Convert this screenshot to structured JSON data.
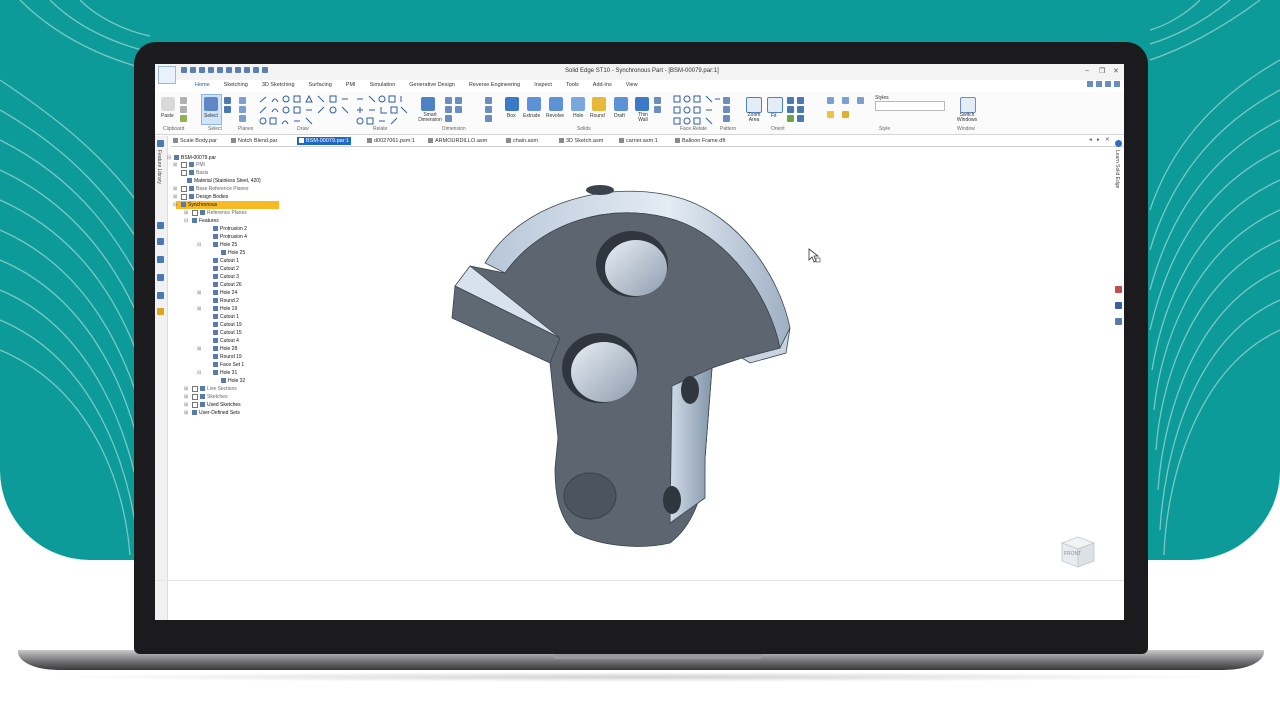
{
  "app": {
    "title": "Solid Edge ST10 - Synchronous Part - [BSM-00079.par:1]",
    "window_buttons": {
      "minimize": "–",
      "restore": "❐",
      "close": "✕"
    }
  },
  "ribbon": {
    "tabs": [
      "Home",
      "Sketching",
      "3D Sketching",
      "Surfacing",
      "PMI",
      "Simulation",
      "Generative Design",
      "Reverse Engineering",
      "Inspect",
      "Tools",
      "Add-Ins",
      "View"
    ],
    "active_tab": "Home",
    "buttons": {
      "paste": "Paste",
      "select": "Select",
      "smart_dimension": "Smart Dimension",
      "box": "Box",
      "extrude": "Extrude",
      "revolve": "Revolve",
      "hole": "Hole",
      "round": "Round",
      "draft": "Draft",
      "thin_wall": "Thin Wall",
      "zoom_area": "Zoom Area",
      "fit": "Fit",
      "styles": "Styles",
      "switch_windows": "Switch Windows"
    },
    "groups": {
      "clipboard": "Clipboard",
      "select": "Select",
      "planes": "Planes",
      "draw": "Draw",
      "relate": "Relate",
      "dimension": "Dimension",
      "solids": "Solids",
      "face_relate": "Face Relate",
      "pattern": "Pattern",
      "orient": "Orient",
      "style": "Style",
      "window": "Window"
    }
  },
  "doc_tabs": [
    "Scale Body.par",
    "Notch Blend.par",
    "BSM-00079.par:1",
    "d0027061.psm:1",
    "ARMOURDILLO.asm",
    "chain.asm",
    "3D Sketch.asm",
    "carrier.asm:1",
    "Balloon Frame.dft"
  ],
  "active_doc_tab": "BSM-00079.par:1",
  "left_strip": {
    "label": "Feature Library"
  },
  "right_strip": {
    "label": "Learn Solid Edge"
  },
  "tree": {
    "root": "BSM-00079.par",
    "items": [
      "PMI",
      "Basis",
      "Material (Stainless Steel, 420)",
      "Base Reference Planes",
      "Design Bodies",
      "Synchronous",
      "Reference Planes",
      "Features",
      "Protrusion 2",
      "Protrusion 4",
      "Hole 25",
      "Hole 25",
      "Cutout 1",
      "Cutout 2",
      "Cutout 3",
      "Cutout 26",
      "Hole 24",
      "Round 2",
      "Hole 19",
      "Cutout 1",
      "Cutout 19",
      "Cutout 15",
      "Cutout 4",
      "Hole 28",
      "Round 19",
      "Face Set 1",
      "Hole 31",
      "Hole 32",
      "Live Sections",
      "Sketches",
      "Used Sketches",
      "User-Defined Sets"
    ]
  },
  "viewcube": {
    "label": "FRONT"
  },
  "colors": {
    "teal": "#0c9b98",
    "accent": "#1f69c4",
    "highlight": "#f7b924",
    "model_dark": "#5d6670",
    "model_light": "#c2d0e0"
  }
}
